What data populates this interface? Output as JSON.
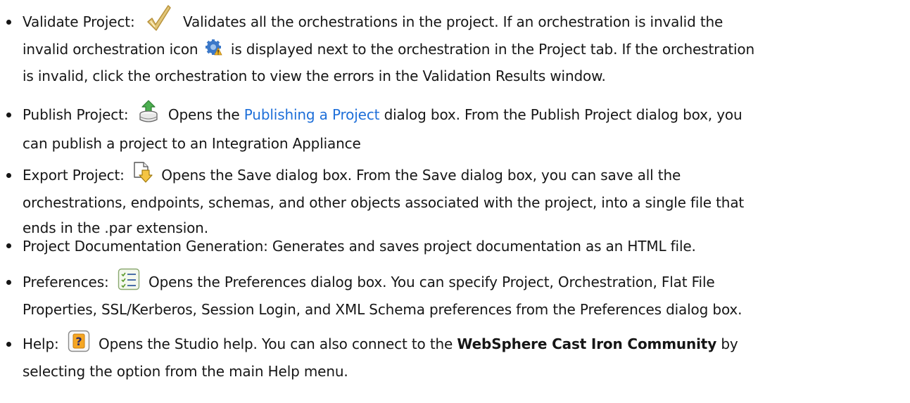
{
  "items": [
    {
      "label": "Validate Project:",
      "icon": "checkmark-icon",
      "lines": [
        "Validates all the orchestrations in the project. If an orchestration is invalid the",
        "is displayed next to the orchestration in the Project tab. If the orchestration",
        "is invalid, click the orchestration to view the errors in the Validation Results window."
      ],
      "inline_prefix": "invalid orchestration icon",
      "inline_icon": "invalid-orchestration-icon"
    },
    {
      "label": "Publish Project:",
      "icon": "publish-icon",
      "text_before_link": "Opens the",
      "link": "Publishing a Project",
      "text_after_link": "dialog box. From the Publish Project dialog box, you",
      "line2": "can publish a project to an Integration Appliance"
    },
    {
      "label": "Export Project:",
      "icon": "export-icon",
      "line1": "Opens the Save dialog box. From the Save dialog box, you can save all the",
      "line2": "orchestrations, endpoints, schemas, and other objects associated with the project, into a single file that",
      "line3": "ends in the .par extension."
    },
    {
      "line1": "Project Documentation Generation: Generates and saves project documentation as an HTML file."
    },
    {
      "label": "Preferences:",
      "icon": "preferences-icon",
      "line1": "Opens the Preferences dialog box. You can specify Project, Orchestration, Flat File",
      "line2": "Properties, SSL/Kerberos, Session Login, and XML Schema preferences from the Preferences dialog box."
    },
    {
      "label": "Help:",
      "icon": "help-icon",
      "line1_before": "Opens the Studio help. You can also connect to the",
      "line1_bold": "WebSphere Cast Iron Community",
      "line1_after": "by",
      "line2": "selecting the option from the main Help menu."
    }
  ],
  "colors": {
    "text": "#161616",
    "link": "#1e6fd9",
    "check": "#d8b45a",
    "publish_green": "#3fa34d",
    "help_orange": "#f0a020"
  }
}
